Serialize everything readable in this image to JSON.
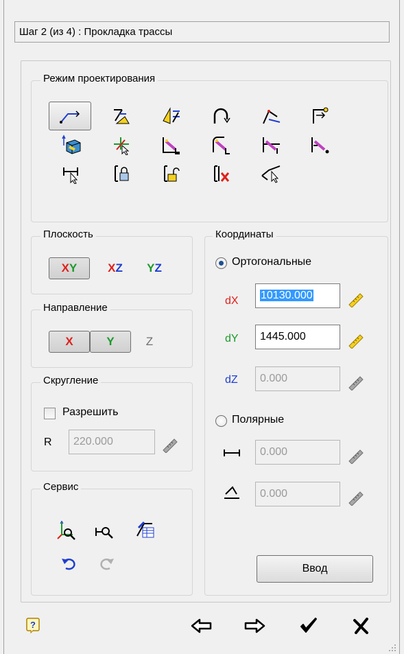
{
  "title": "Шаг 2 (из 4) : Прокладка трассы",
  "design_mode": {
    "label": "Режим проектирования",
    "tools": [
      "polyline-segment-icon",
      "offset-segment-icon",
      "mirror-segment-icon",
      "arc-segment-icon",
      "branch-segment-icon",
      "endpoint-flag-icon",
      "connect-object-icon",
      "snap-cursor-icon",
      "pick-nozzle-1-icon",
      "pick-nozzle-2-icon",
      "pick-nozzle-3-icon",
      "pick-nozzle-4-icon",
      "dimension-pick-icon",
      "lock-segment-icon",
      "unlock-segment-icon",
      "delete-segment-icon",
      "angle-pick-icon"
    ]
  },
  "plane": {
    "label": "Плоскость",
    "xy": "XY",
    "xz": "XZ",
    "yz": "YZ"
  },
  "direction": {
    "label": "Направление",
    "x": "X",
    "y": "Y",
    "z": "Z"
  },
  "rounding": {
    "label": "Скругление",
    "allow": "Разрешить",
    "r_label": "R",
    "r_value": "220.000"
  },
  "service": {
    "label": "Сервис"
  },
  "coords": {
    "label": "Координаты",
    "ortho": "Ортогональные",
    "dx_label": "dX",
    "dx_value": "10130.000",
    "dy_label": "dY",
    "dy_value": "1445.000",
    "dz_label": "dZ",
    "dz_value": "0.000",
    "polar": "Полярные",
    "len_value": "0.000",
    "angle_value": "0.000",
    "enter": "Ввод"
  },
  "colors": {
    "red": "#e0201b",
    "green": "#1a9a2a",
    "blue": "#1f3fd0"
  }
}
